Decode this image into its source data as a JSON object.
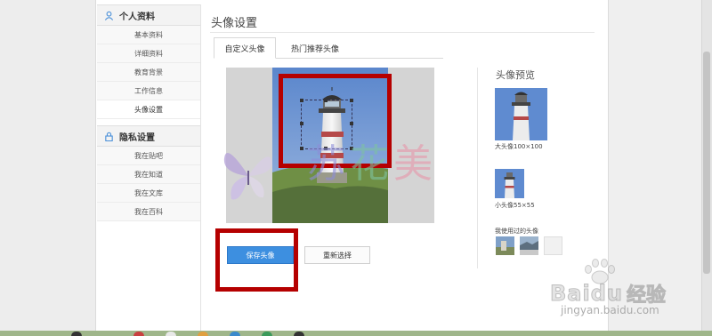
{
  "sidebar": {
    "sections": [
      {
        "title": "个人资料",
        "icon": "user-icon",
        "items": [
          {
            "label": "基本资料"
          },
          {
            "label": "详细资料"
          },
          {
            "label": "教育背景"
          },
          {
            "label": "工作信息"
          },
          {
            "label": "头像设置",
            "active": true
          }
        ]
      },
      {
        "title": "隐私设置",
        "icon": "lock-icon",
        "items": [
          {
            "label": "我在贴吧"
          },
          {
            "label": "我在知道"
          },
          {
            "label": "我在文库"
          },
          {
            "label": "我在百科"
          }
        ]
      }
    ]
  },
  "main": {
    "title": "头像设置",
    "tabs": [
      {
        "label": "自定义头像",
        "active": true
      },
      {
        "label": "热门推荐头像",
        "active": false
      }
    ],
    "buttons": {
      "save": "保存头像",
      "reselect": "重新选择"
    }
  },
  "preview": {
    "title": "头像预览",
    "big_caption": "大头像100×100",
    "small_caption": "小头像55×55",
    "used_title": "我使用过的头像"
  },
  "watermark": {
    "text": "苏花美",
    "brand": "Baidu",
    "brand_cn": "经验",
    "url": "jingyan.baidu.com"
  },
  "colors": {
    "accent": "#3d8fe0",
    "highlight": "#b50000",
    "sidebar_icon": "#4a90d9"
  }
}
